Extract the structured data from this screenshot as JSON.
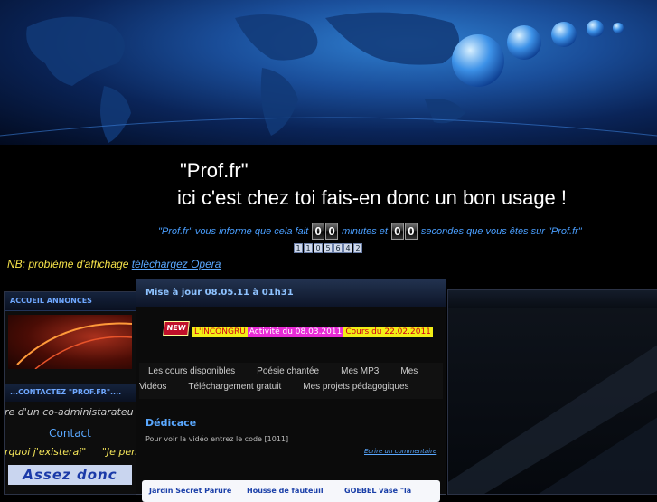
{
  "header": {
    "title_line1": "\"Prof.fr\"",
    "title_line2": "ici c'est chez toi fais-en donc un bon usage !",
    "counter_prefix": "\"Prof.fr\" vous informe que cela fait",
    "minutes_digits": [
      "0",
      "0"
    ],
    "counter_middle": "minutes et",
    "seconds_digits": [
      "0",
      "0"
    ],
    "counter_suffix": "secondes que vous êtes sur \"Prof.fr\"",
    "hit_counter_digits": [
      "1",
      "1",
      "0",
      "5",
      "6",
      "4",
      "2"
    ]
  },
  "notice": {
    "text": "NB: problème d'affichage",
    "link_label": "téléchargez Opera"
  },
  "sidebar": {
    "section1_title": "ACCUEIL ANNONCES",
    "section2_title": "...CONTACTEZ \"PROF.FR\"....",
    "marquee1": "re d'un co-administarateu",
    "contact_label": "Contact",
    "marquee2_a": "rquoi j'existerai\"",
    "marquee2_b": "\"Je pen",
    "banner_text": "Assez donc"
  },
  "main": {
    "update_title": "Mise à jour 08.05.11 à 01h31",
    "new_badge": "NEW",
    "ticker_1": "L'INCONGRU",
    "ticker_2": "Activité du 08.03.2011",
    "ticker_3": "Cours du 22.02.2011",
    "menu_row1": [
      "Les cours disponibles",
      "Poésie chantée",
      "Mes MP3",
      "Mes"
    ],
    "menu_row2": [
      "Vidéos",
      "Téléchargement gratuit",
      "Mes projets pédagogiques"
    ],
    "dedicace_title": "Dédicace",
    "dedicace_text": "Pour voir la vidéo entrez le code [1011]",
    "comment_link": "Ecrire un commentaire",
    "links": [
      "Jardin Secret Parure",
      "Housse de fauteuil",
      "GOEBEL vase \"la"
    ]
  },
  "colors": {
    "accent_blue": "#5aa8ff",
    "notice_yellow": "#f7e34a",
    "new_red": "#c0102a"
  }
}
